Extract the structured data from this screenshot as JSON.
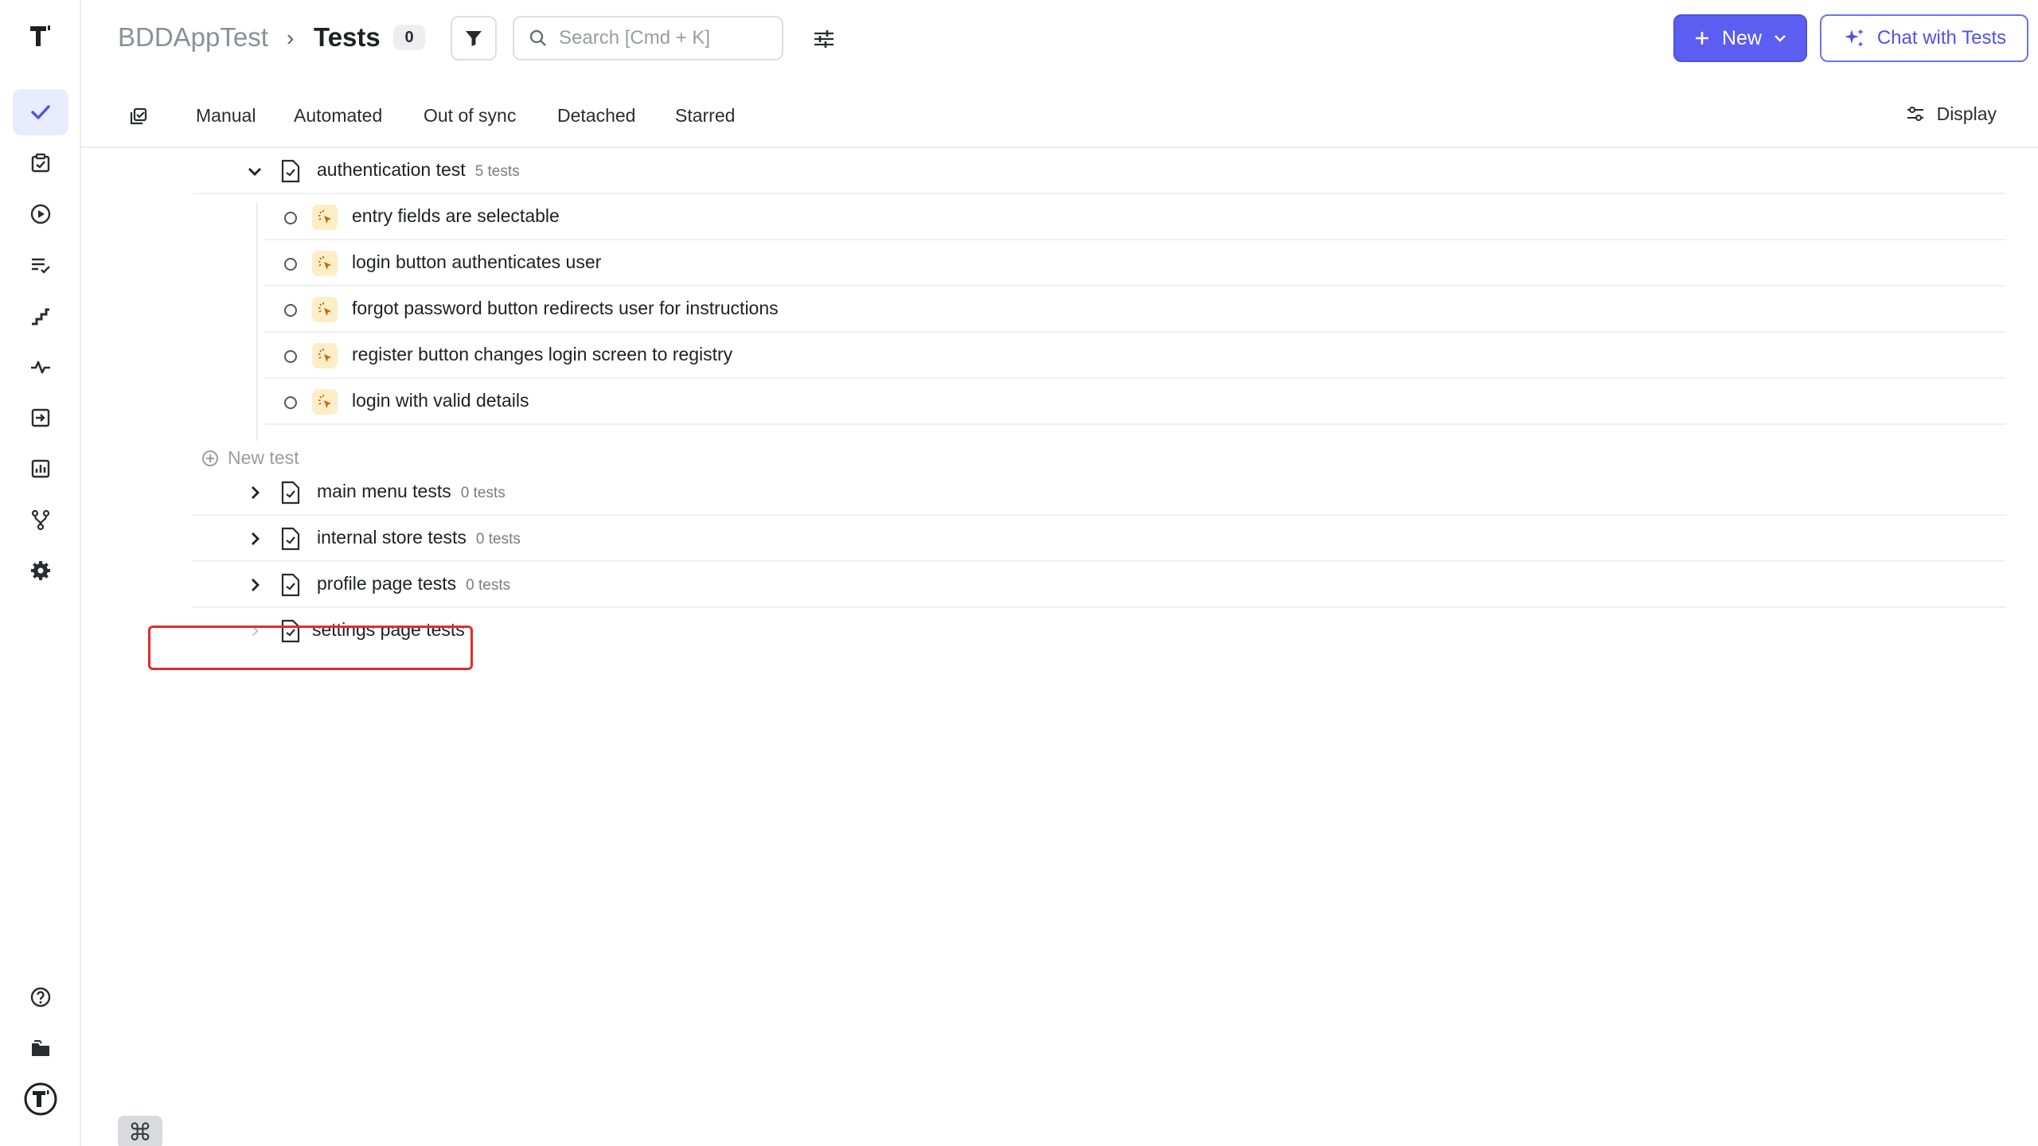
{
  "sidebar": {
    "logo": "testing-app-logo",
    "items": [
      {
        "icon": "checkmark-icon",
        "active": true
      },
      {
        "icon": "clipboard-check-icon"
      },
      {
        "icon": "play-circle-icon"
      },
      {
        "icon": "list-check-icon"
      },
      {
        "icon": "stairs-icon"
      },
      {
        "icon": "pulse-icon"
      },
      {
        "icon": "import-icon"
      },
      {
        "icon": "bar-chart-icon"
      },
      {
        "icon": "branch-icon"
      },
      {
        "icon": "gear-icon"
      }
    ],
    "bottom": [
      {
        "icon": "help-icon"
      },
      {
        "icon": "folder-icon"
      },
      {
        "icon": "account-logo-icon"
      }
    ]
  },
  "header": {
    "project": "BDDAppTest",
    "separator": "›",
    "page": "Tests",
    "count": "0",
    "search_placeholder": "Search [Cmd + K]",
    "new_label": "New",
    "chat_label": "Chat with Tests"
  },
  "tabs": {
    "items": [
      "Manual",
      "Automated",
      "Out of sync",
      "Detached",
      "Starred"
    ],
    "display_label": "Display"
  },
  "tree": {
    "expanded_folder": {
      "name": "authentication test",
      "meta": "5 tests",
      "tests": [
        "entry fields are selectable",
        "login button authenticates user",
        "forgot password button redirects user for instructions",
        "register button changes login screen to registry",
        "login with valid details"
      ],
      "new_test_label": "New test"
    },
    "folders": [
      {
        "name": "main menu tests",
        "meta": "0 tests"
      },
      {
        "name": "internal store tests",
        "meta": "0 tests"
      },
      {
        "name": "profile page tests",
        "meta": "0 tests"
      },
      {
        "name": "settings page tests",
        "meta": ""
      }
    ]
  },
  "footer": {
    "shortcut_glyph": "⌘"
  },
  "colors": {
    "accent": "#5b5ef0",
    "highlight": "#e52b2b",
    "badge_bg": "#fdeec8"
  }
}
